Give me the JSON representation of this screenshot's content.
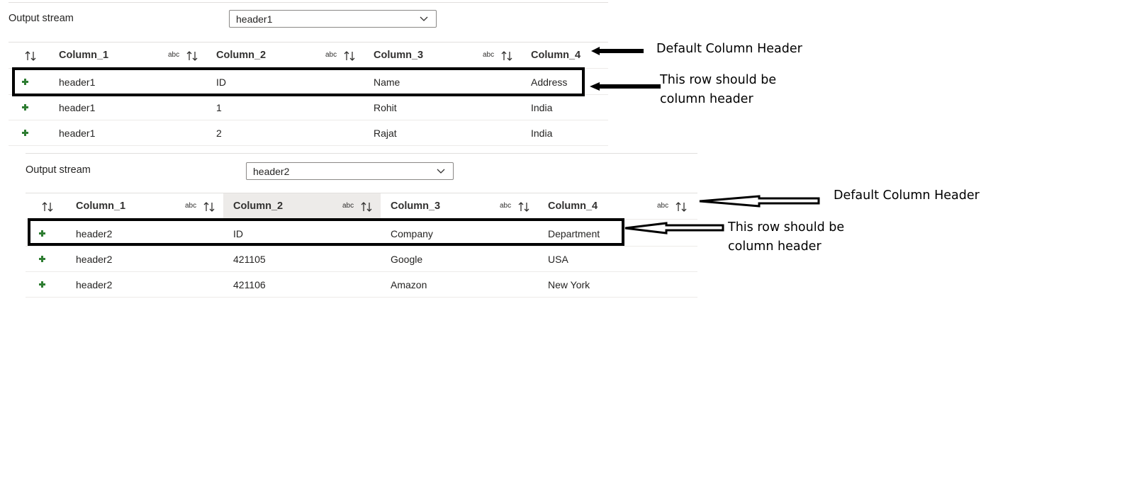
{
  "panels": [
    {
      "output_label": "Output stream",
      "selected_stream": "header1",
      "columns": [
        {
          "name": "Column_1",
          "type_badge": "abc"
        },
        {
          "name": "Column_2",
          "type_badge": "abc"
        },
        {
          "name": "Column_3",
          "type_badge": "abc"
        },
        {
          "name": "Column_4",
          "type_badge": ""
        }
      ],
      "rows": [
        [
          "header1",
          "ID",
          "Name",
          "Address"
        ],
        [
          "header1",
          "1",
          "Rohit",
          "India"
        ],
        [
          "header1",
          "2",
          "Rajat",
          "India"
        ]
      ]
    },
    {
      "output_label": "Output stream",
      "selected_stream": "header2",
      "columns": [
        {
          "name": "Column_1",
          "type_badge": "abc"
        },
        {
          "name": "Column_2",
          "type_badge": "abc"
        },
        {
          "name": "Column_3",
          "type_badge": "abc"
        },
        {
          "name": "Column_4",
          "type_badge": "abc"
        }
      ],
      "rows": [
        [
          "header2",
          "ID",
          "Company",
          "Department"
        ],
        [
          "header2",
          "421105",
          "Google",
          "USA"
        ],
        [
          "header2",
          "421106",
          "Amazon",
          "New York"
        ]
      ]
    }
  ],
  "annotations": {
    "default_header_1": "Default Column Header",
    "row_note_1_line1": "This row should be",
    "row_note_1_line2": "column header",
    "default_header_2": "Default Column Header",
    "row_note_2_line1": "This row should be",
    "row_note_2_line2": "column header"
  }
}
